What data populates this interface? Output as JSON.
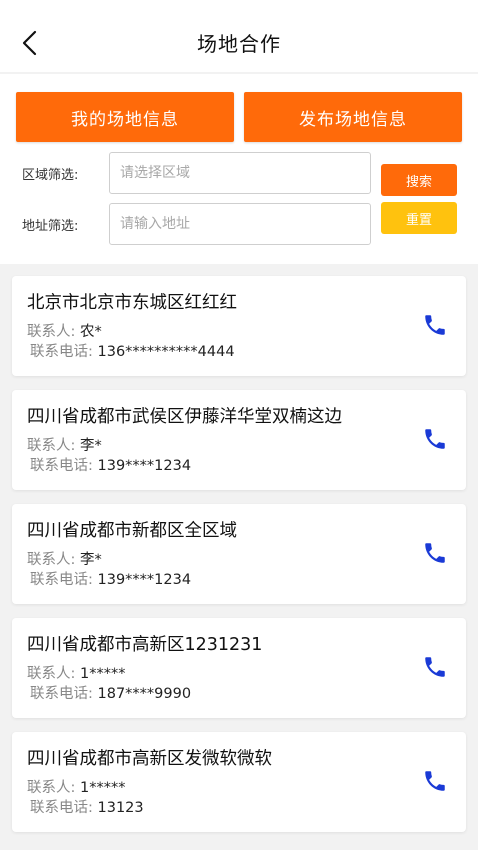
{
  "header": {
    "title": "场地合作"
  },
  "actions": {
    "my_venue_label": "我的场地信息",
    "publish_venue_label": "发布场地信息"
  },
  "filters": {
    "region_label": "区域筛选:",
    "region_placeholder": "请选择区域",
    "address_label": "地址筛选:",
    "address_placeholder": "请输入地址",
    "search_label": "搜索",
    "reset_label": "重置"
  },
  "colors": {
    "accent": "#ff6a0a",
    "reset": "#ffc20e",
    "phone": "#1a3ad6"
  },
  "venues": [
    {
      "title": "北京市北京市东城区红红红",
      "contact_label": "联系人:",
      "contact": "农*",
      "phone_label": "联系电话:",
      "phone": "136**********4444"
    },
    {
      "title": "四川省成都市武侯区伊藤洋华堂双楠这边",
      "contact_label": "联系人:",
      "contact": "李*",
      "phone_label": "联系电话:",
      "phone": "139****1234"
    },
    {
      "title": "四川省成都市新都区全区域",
      "contact_label": "联系人:",
      "contact": "李*",
      "phone_label": "联系电话:",
      "phone": "139****1234"
    },
    {
      "title": "四川省成都市高新区1231231",
      "contact_label": "联系人:",
      "contact": "1*****",
      "phone_label": "联系电话:",
      "phone": "187****9990"
    },
    {
      "title": "四川省成都市高新区发微软微软",
      "contact_label": "联系人:",
      "contact": "1*****",
      "phone_label": "联系电话:",
      "phone": "13123"
    }
  ]
}
